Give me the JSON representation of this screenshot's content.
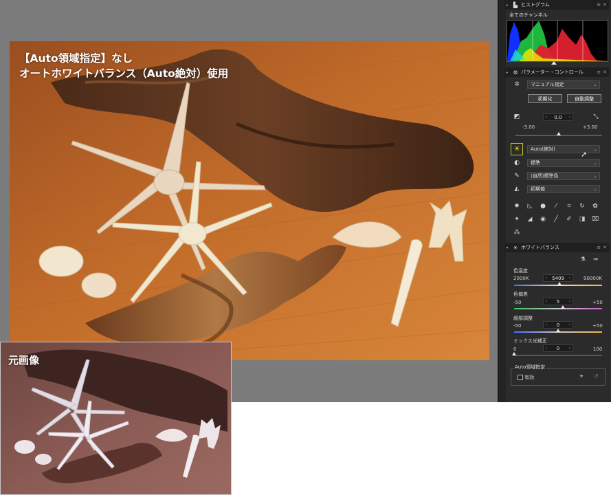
{
  "overlay": {
    "line1": "【Auto領域指定】なし",
    "line2": "オートホワイトバランス（Auto絶対）使用"
  },
  "original_label": "元画像",
  "palette": {
    "histogram": {
      "title": "ヒストグラム",
      "channel": "全てのチャンネル",
      "header_buttons": [
        "≡",
        "✕"
      ]
    },
    "parameter_control": {
      "title": "パラメーター・コントロール",
      "mode": "マニュアル指定",
      "reset_button": "初期化",
      "auto_button": "自動調整",
      "exposure": {
        "value": "0.0",
        "min": "-3.00",
        "max": "+3.00"
      },
      "white_balance_mode": "Auto(絶対)",
      "tone": "標準",
      "color": "(自然)標準色",
      "sharpness": "初期値"
    },
    "white_balance": {
      "title": "ホワイトバランス",
      "color_temperature": {
        "label": "色温度",
        "value": "5409",
        "min": "2000K",
        "max": "90000K",
        "level": 0.039
      },
      "tint": {
        "label": "色偏差",
        "value": "5",
        "min": "-50",
        "max": "+50",
        "level": 0.55
      },
      "fine_tune": {
        "label": "細部調整",
        "value": "0",
        "min": "-50",
        "max": "+50",
        "level": 0.5
      },
      "mixed_light": {
        "label": "ミックス光補正",
        "value": "0",
        "min": "0",
        "max": "100",
        "level": 0.0
      },
      "auto_area": {
        "title": "Auto領域指定",
        "enable_label": "有効",
        "enabled": false
      }
    }
  },
  "icons": {
    "histogram": "histogram-icon",
    "parameter": "camera-settings-icon",
    "white_balance": "sun-icon"
  }
}
